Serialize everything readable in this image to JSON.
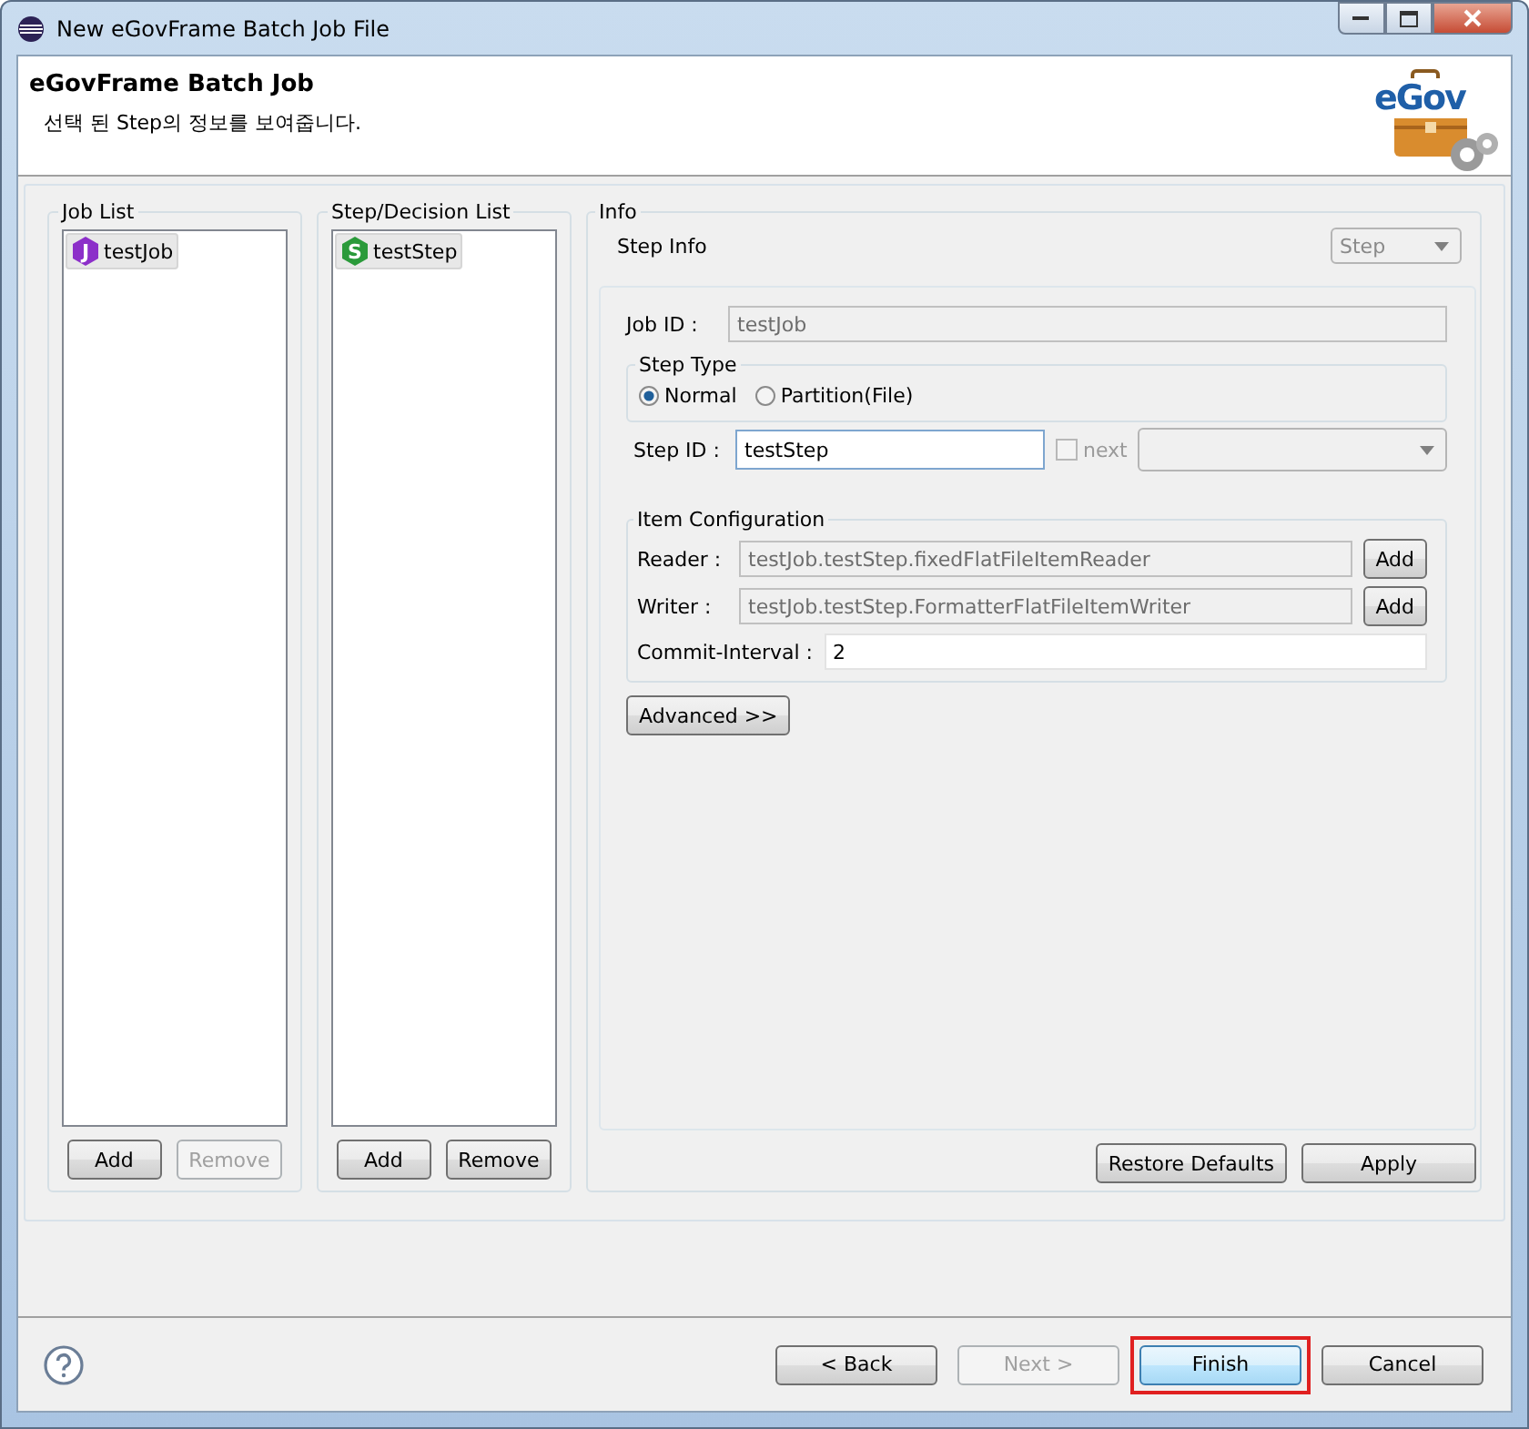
{
  "window": {
    "title": "New eGovFrame Batch Job File"
  },
  "banner": {
    "title": "eGovFrame Batch Job",
    "description": "선택 된 Step의 정보를 보여줍니다.",
    "logo_text": "eGov"
  },
  "job_list": {
    "title": "Job List",
    "items": [
      {
        "badge": "J",
        "label": "testJob",
        "selected": true
      }
    ],
    "buttons": [
      {
        "label": "Add",
        "disabled": false
      },
      {
        "label": "Remove",
        "disabled": true
      }
    ]
  },
  "step_list": {
    "title": "Step/Decision List",
    "items": [
      {
        "badge": "S",
        "label": "testStep",
        "selected": true
      }
    ],
    "buttons": [
      {
        "label": "Add",
        "disabled": false
      },
      {
        "label": "Remove",
        "disabled": false
      }
    ]
  },
  "info": {
    "title": "Info",
    "section_title": "Step Info",
    "type_select": {
      "value": "Step",
      "disabled": true
    },
    "job_id": {
      "label": "Job ID :",
      "value": "testJob",
      "disabled": true
    },
    "step_type": {
      "title": "Step Type",
      "options": [
        {
          "label": "Normal",
          "selected": true
        },
        {
          "label": "Partition(File)",
          "selected": false
        }
      ]
    },
    "step_id": {
      "label": "Step ID :",
      "value": "testStep"
    },
    "next": {
      "label": "next",
      "checked": false,
      "disabled": true
    },
    "item_config": {
      "title": "Item Configuration",
      "rows": [
        {
          "label": "Reader :",
          "value": "testJob.testStep.fixedFlatFileItemReader",
          "button": "Add"
        },
        {
          "label": "Writer :",
          "value": "testJob.testStep.FormatterFlatFileItemWriter",
          "button": "Add"
        }
      ],
      "commit": {
        "label": "Commit-Interval :",
        "value": "2"
      }
    },
    "advanced_button": "Advanced >>",
    "buttons": [
      {
        "label": "Restore Defaults"
      },
      {
        "label": "Apply"
      }
    ]
  },
  "footer": {
    "buttons": [
      {
        "label": "< Back",
        "disabled": false,
        "default": false,
        "highlighted": false
      },
      {
        "label": "Next >",
        "disabled": true,
        "default": false,
        "highlighted": false
      },
      {
        "label": "Finish",
        "disabled": false,
        "default": true,
        "highlighted": true
      },
      {
        "label": "Cancel",
        "disabled": false,
        "default": false,
        "highlighted": false
      }
    ]
  }
}
